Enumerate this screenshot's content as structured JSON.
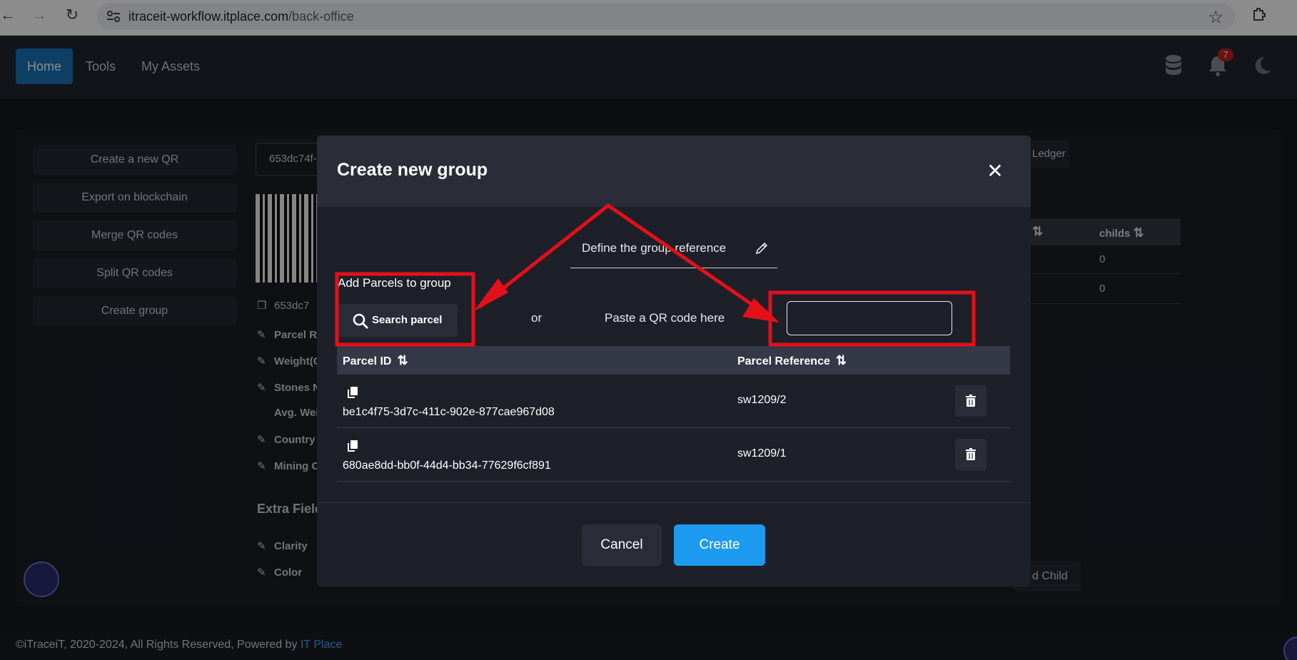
{
  "browser": {
    "url_host": "itraceit-workflow.itplace.com",
    "url_path": "/back-office"
  },
  "header": {
    "tabs": [
      {
        "label": "Home",
        "active": true
      },
      {
        "label": "Tools",
        "active": false
      },
      {
        "label": "My Assets",
        "active": false
      }
    ],
    "notification_count": "7",
    "icons": [
      "database-icon",
      "bell-icon",
      "moon-icon"
    ]
  },
  "sidebar": {
    "items": [
      {
        "label": "Create a new QR"
      },
      {
        "label": "Export on blockchain"
      },
      {
        "label": "Merge QR codes"
      },
      {
        "label": "Split QR codes"
      },
      {
        "label": "Create group"
      }
    ]
  },
  "background": {
    "qr_id_input": "653dc74f-",
    "qr_id_text": "653dc7",
    "fields": [
      "Parcel Re",
      "Weight(C",
      "Stones N",
      "Avg. Weig",
      "Country",
      "Mining Co"
    ],
    "extra_title": "Extra Field",
    "extra_fields": [
      "Clarity",
      "Color"
    ],
    "ledger_label": "Ledger",
    "table_header": "childs",
    "table_values": [
      "0",
      "0"
    ],
    "child_button": "d Child"
  },
  "modal": {
    "title": "Create new group",
    "group_reference_label": "Define the group reference",
    "add_parcels_label": "Add Parcels to group",
    "search_button": "Search parcel",
    "or_text": "or",
    "paste_label": "Paste a QR code here",
    "paste_value": "",
    "columns": [
      "Parcel ID",
      "Parcel Reference"
    ],
    "rows": [
      {
        "parcel_id": "be1c4f75-3d7c-411c-902e-877cae967d08",
        "reference": "sw1209/2"
      },
      {
        "parcel_id": "680ae8dd-bb0f-44d4-bb34-77629f6cf891",
        "reference": "sw1209/1"
      }
    ],
    "cancel_button": "Cancel",
    "create_button": "Create"
  },
  "footer": {
    "text": "©iTraceiT, 2020-2024, All Rights Reserved, Powered by ",
    "link": "IT Place"
  },
  "colors": {
    "accent": "#1d9bf0",
    "annotation": "#e3101a",
    "active_tab": "#1a73b8"
  }
}
